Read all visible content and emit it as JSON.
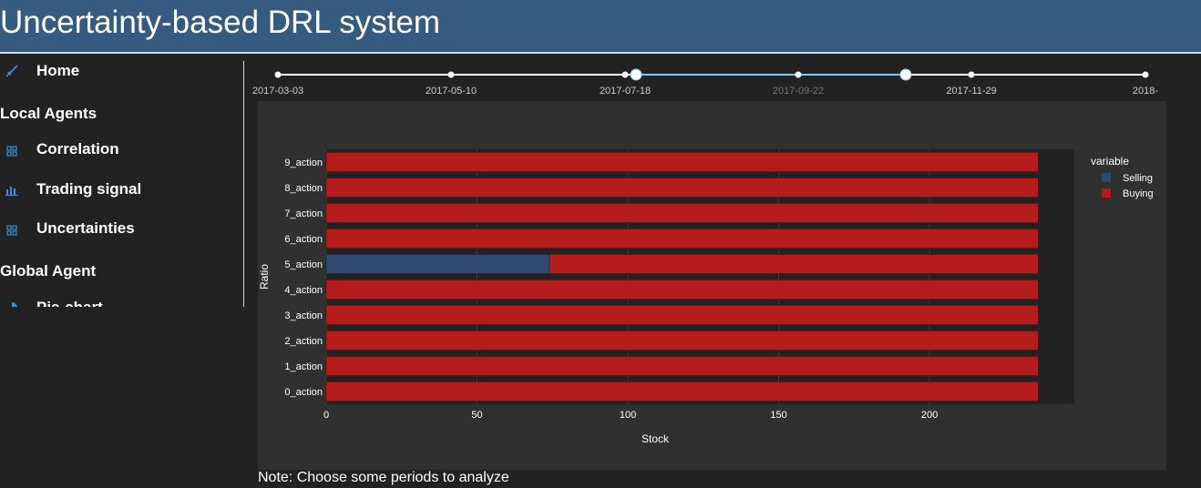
{
  "header": {
    "title": "Uncertainty-based DRL system"
  },
  "sidebar": {
    "home": {
      "label": "Home",
      "icon": "rocket-icon"
    },
    "local_agents_title": "Local Agents",
    "local_items": [
      {
        "label": "Correlation",
        "icon": "grid-icon"
      },
      {
        "label": "Trading signal",
        "icon": "bar-chart-icon"
      },
      {
        "label": "Uncertainties",
        "icon": "grid-icon"
      }
    ],
    "global_agent_title": "Global Agent",
    "global_items": [
      {
        "label": "Pie-chart",
        "icon": "pie-chart-icon"
      }
    ]
  },
  "slider": {
    "marks": [
      "2017-03-03",
      "2017-05-10",
      "2017-07-18",
      "2017-09-22",
      "2017-11-29",
      "2018-"
    ],
    "selected_range": [
      "2017-07-18",
      "2017-10-26"
    ],
    "track_color": "#ffffff",
    "range_color": "#7ec8f0"
  },
  "chart_data": {
    "type": "bar",
    "orientation": "horizontal",
    "stacked": true,
    "categories": [
      "0_action",
      "1_action",
      "2_action",
      "3_action",
      "4_action",
      "5_action",
      "6_action",
      "7_action",
      "8_action",
      "9_action"
    ],
    "series": [
      {
        "name": "Selling",
        "color": "#2e4a70",
        "values": [
          0,
          0,
          0,
          0,
          0,
          74,
          0,
          0,
          0,
          0
        ]
      },
      {
        "name": "Buying",
        "color": "#b71c1c",
        "values": [
          236,
          236,
          236,
          236,
          236,
          162,
          236,
          236,
          236,
          236
        ]
      }
    ],
    "xlabel": "Stock",
    "ylabel": "Ratio",
    "xticks": [
      0,
      50,
      100,
      150,
      200
    ],
    "xlim": [
      0,
      248
    ],
    "legend_title": "variable",
    "legend_position": "top-right"
  },
  "note": "Note: Choose some periods to analyze"
}
